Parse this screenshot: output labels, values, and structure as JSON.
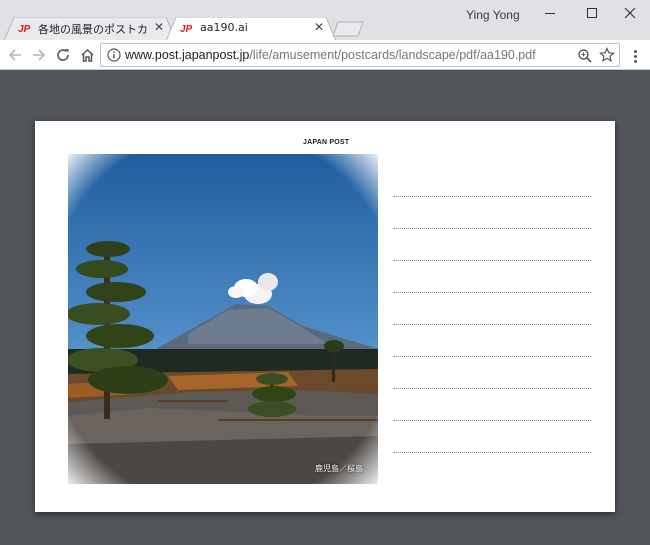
{
  "window": {
    "user_name": "Ying Yong"
  },
  "tabs": [
    {
      "label": "各地の風景のポストカー",
      "active": false
    },
    {
      "label": "aa190.ai",
      "active": true
    }
  ],
  "toolbar": {
    "url_host": "www.post.japanpost.jp",
    "url_path": "/life/amusement/postcards/landscape/pdf/aa190.pdf"
  },
  "postcard": {
    "brand": "JAPAN POST",
    "caption": "鹿児島／桜島",
    "address_line_count": 9
  },
  "colors": {
    "viewer_bg": "#525659",
    "tab_bar_bg": "#dfe1e5",
    "favicon_red": "#d81e1e"
  }
}
